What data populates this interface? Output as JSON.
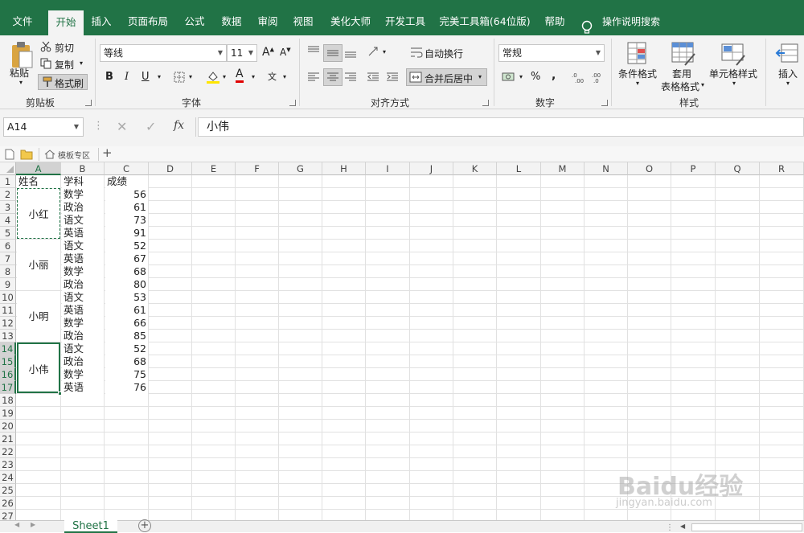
{
  "menu_tabs": [
    "文件",
    "开始",
    "插入",
    "页面布局",
    "公式",
    "数据",
    "审阅",
    "视图",
    "美化大师",
    "开发工具",
    "完美工具箱(64位版)",
    "帮助"
  ],
  "search_label": "操作说明搜索",
  "clipboard": {
    "paste": "粘贴",
    "cut": "剪切",
    "copy": "复制",
    "format_painter": "格式刷",
    "label": "剪贴板"
  },
  "font": {
    "name": "等线",
    "size": "11",
    "grow": "A",
    "shrink": "A",
    "bold": "B",
    "italic": "I",
    "underline": "U",
    "font_color_glyph": "A",
    "phonetic_glyph": "文",
    "label": "字体"
  },
  "alignment": {
    "wrap": "自动换行",
    "merge": "合并后居中",
    "label": "对齐方式"
  },
  "number": {
    "format": "常规",
    "percent": "%",
    "comma": ",",
    "label": "数字"
  },
  "styles": {
    "cond": "条件格式",
    "table1": "套用",
    "table2": "表格格式",
    "cell": "单元格样式",
    "label": "样式"
  },
  "insert": {
    "label": "插入"
  },
  "formula_bar": {
    "cell_ref": "A14",
    "fx": "fx",
    "content": "小伟"
  },
  "template_bar": {
    "label": "模板专区"
  },
  "columns": [
    "A",
    "B",
    "C",
    "D",
    "E",
    "F",
    "G",
    "H",
    "I",
    "J",
    "K",
    "L",
    "M",
    "N",
    "O",
    "P",
    "Q",
    "R"
  ],
  "rows": [
    "1",
    "2",
    "3",
    "4",
    "5",
    "6",
    "7",
    "8",
    "9",
    "10",
    "11",
    "12",
    "13",
    "14",
    "15",
    "16",
    "17",
    "18",
    "19",
    "20",
    "21",
    "22",
    "23",
    "24",
    "25",
    "26",
    "27"
  ],
  "header_row": [
    "姓名",
    "学科",
    "成绩"
  ],
  "names": [
    "小红",
    "小丽",
    "小明",
    "小伟"
  ],
  "subjects": [
    "数学",
    "政治",
    "语文",
    "英语",
    "语文",
    "英语",
    "数学",
    "政治",
    "语文",
    "英语",
    "数学",
    "政治",
    "语文",
    "政治",
    "数学",
    "英语"
  ],
  "scores": [
    "56",
    "61",
    "73",
    "91",
    "52",
    "67",
    "68",
    "80",
    "53",
    "61",
    "66",
    "85",
    "52",
    "68",
    "75",
    "76"
  ],
  "sheet": {
    "name": "Sheet1",
    "add": "+"
  },
  "watermark": {
    "brand": "Baidu经验",
    "url": "jingyan.baidu.com"
  },
  "colors": {
    "accent": "#217346",
    "ribbon": "#f3f3f3"
  }
}
